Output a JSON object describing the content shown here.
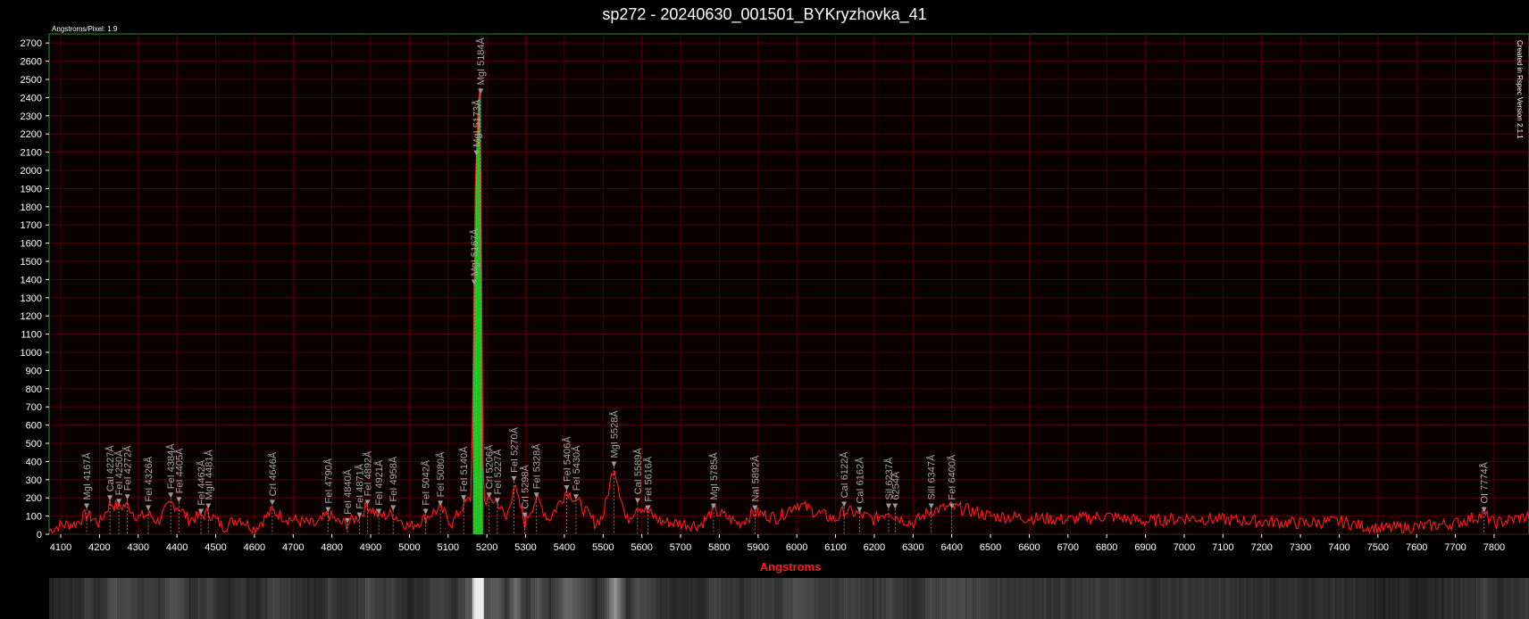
{
  "chart_data": {
    "type": "line",
    "title": "sp272 - 20240630_001501_BYKryzhovka_41",
    "subtitle": "Angstroms/Pixel: 1.9",
    "side_note": "Created in Rspec Version 2.1.1",
    "xlabel": "Angstroms",
    "ylabel": "",
    "xlim": [
      4070,
      7890
    ],
    "ylim": [
      0,
      2750
    ],
    "x_ticks": [
      4100,
      4200,
      4300,
      4400,
      4500,
      4600,
      4700,
      4800,
      4900,
      5000,
      5100,
      5200,
      5300,
      5400,
      5500,
      5600,
      5700,
      5800,
      5900,
      6000,
      6100,
      6200,
      6300,
      6400,
      6500,
      6600,
      6700,
      6800,
      6900,
      7000,
      7100,
      7200,
      7300,
      7400,
      7500,
      7600,
      7700,
      7800
    ],
    "y_ticks": [
      0,
      100,
      200,
      300,
      400,
      500,
      600,
      700,
      800,
      900,
      1000,
      1100,
      1200,
      1300,
      1400,
      1500,
      1600,
      1700,
      1800,
      1900,
      2000,
      2100,
      2200,
      2300,
      2400,
      2500,
      2600,
      2700
    ],
    "grid": true,
    "colors": {
      "line": "#ff1a1a",
      "grid": "#5a0000",
      "border": "#2a8f2a",
      "peak_fill": "#20d020",
      "marker": "#9a9a9a"
    },
    "series": [
      {
        "x": [
          4070,
          4100,
          4140,
          4167,
          4200,
          4227,
          4250,
          4272,
          4300,
          4326,
          4350,
          4384,
          4405,
          4430,
          4462,
          4481,
          4520,
          4560,
          4600,
          4646,
          4680,
          4720,
          4760,
          4790,
          4820,
          4840,
          4871,
          4892,
          4921,
          4958,
          5000,
          5042,
          5060,
          5080,
          5110,
          5140,
          5160,
          5167,
          5170,
          5173,
          5176,
          5180,
          5184,
          5188,
          5192,
          5206,
          5227,
          5250,
          5270,
          5298,
          5310,
          5328,
          5360,
          5406,
          5430,
          5480,
          5500,
          5528,
          5560,
          5589,
          5616,
          5650,
          5700,
          5750,
          5785,
          5850,
          5892,
          5950,
          6000,
          6050,
          6100,
          6122,
          6162,
          6200,
          6237,
          6254,
          6300,
          6347,
          6400,
          6450,
          6500,
          6600,
          6700,
          6800,
          6900,
          7000,
          7100,
          7200,
          7300,
          7400,
          7500,
          7600,
          7700,
          7774,
          7800,
          7890
        ],
        "y": [
          20,
          50,
          60,
          110,
          60,
          170,
          150,
          160,
          90,
          110,
          70,
          170,
          150,
          80,
          100,
          120,
          40,
          90,
          30,
          130,
          90,
          70,
          50,
          110,
          60,
          60,
          100,
          160,
          100,
          110,
          40,
          90,
          120,
          140,
          60,
          160,
          200,
          1350,
          1900,
          2100,
          2300,
          2440,
          2470,
          600,
          180,
          190,
          180,
          80,
          270,
          60,
          120,
          200,
          80,
          240,
          190,
          60,
          100,
          380,
          70,
          160,
          120,
          70,
          60,
          50,
          130,
          60,
          120,
          90,
          170,
          120,
          80,
          130,
          110,
          80,
          130,
          100,
          60,
          130,
          150,
          130,
          100,
          90,
          80,
          100,
          70,
          90,
          80,
          70,
          60,
          70,
          30,
          40,
          60,
          110,
          60,
          100
        ]
      }
    ],
    "annotations": [
      {
        "x": 4167,
        "text": "MgI 4167Å",
        "top": 140
      },
      {
        "x": 4227,
        "text": "CaI 4227Å",
        "top": 185
      },
      {
        "x": 4250,
        "text": "FeI 4250Å",
        "top": 165
      },
      {
        "x": 4272,
        "text": "FeI 4272Å",
        "top": 190
      },
      {
        "x": 4326,
        "text": "FeI 4326Å",
        "top": 130
      },
      {
        "x": 4384,
        "text": "FeI 4384Å",
        "top": 200
      },
      {
        "x": 4405,
        "text": "FeI 4405Å",
        "top": 175
      },
      {
        "x": 4462,
        "text": "FeI 4462Å",
        "top": 110
      },
      {
        "x": 4481,
        "text": "MgII 4481Å",
        "top": 140
      },
      {
        "x": 4646,
        "text": "CrI 4646Å",
        "top": 160
      },
      {
        "x": 4790,
        "text": "FeI 4790Å",
        "top": 120
      },
      {
        "x": 4840,
        "text": "FeI 4840Å",
        "top": 60
      },
      {
        "x": 4871,
        "text": "FeI 4871Å",
        "top": 90
      },
      {
        "x": 4892,
        "text": "FeI 4892Å",
        "top": 160
      },
      {
        "x": 4921,
        "text": "FeI 4921Å",
        "top": 110
      },
      {
        "x": 4958,
        "text": "FeI 4958Å",
        "top": 130
      },
      {
        "x": 5042,
        "text": "FeI 5042Å",
        "top": 110
      },
      {
        "x": 5080,
        "text": "FeI 5080Å",
        "top": 155
      },
      {
        "x": 5140,
        "text": "FeI 5140Å",
        "top": 185
      },
      {
        "x": 5167,
        "text": "MgI 5167Å",
        "top": 1370
      },
      {
        "x": 5173,
        "text": "MgI 5173Å",
        "top": 2080
      },
      {
        "x": 5184,
        "text": "MgI 5184Å",
        "top": 2420
      },
      {
        "x": 5206,
        "text": "CrI 5206Å",
        "top": 200
      },
      {
        "x": 5227,
        "text": "FeI 5227Å",
        "top": 170
      },
      {
        "x": 5270,
        "text": "FeI 5270Å",
        "top": 290
      },
      {
        "x": 5298,
        "text": "CrI 5298Å",
        "top": 90
      },
      {
        "x": 5328,
        "text": "FeI 5328Å",
        "top": 200
      },
      {
        "x": 5406,
        "text": "FeI 5406Å",
        "top": 240
      },
      {
        "x": 5430,
        "text": "FeI 5430Å",
        "top": 190
      },
      {
        "x": 5528,
        "text": "MgI 5528Å",
        "top": 370
      },
      {
        "x": 5589,
        "text": "CaI 5589Å",
        "top": 170
      },
      {
        "x": 5616,
        "text": "FeI 5616Å",
        "top": 130
      },
      {
        "x": 5785,
        "text": "MgI 5785Å",
        "top": 140
      },
      {
        "x": 5892,
        "text": "NaI 5892Å",
        "top": 130
      },
      {
        "x": 6122,
        "text": "CaI 6122Å",
        "top": 150
      },
      {
        "x": 6162,
        "text": "CaI 6162Å",
        "top": 120
      },
      {
        "x": 6237,
        "text": "SiI 6237Å",
        "top": 140
      },
      {
        "x": 6254,
        "text": "6254Å",
        "top": 140
      },
      {
        "x": 6347,
        "text": "SiII 6347Å",
        "top": 140
      },
      {
        "x": 6400,
        "text": "FeI 6400Å",
        "top": 140
      },
      {
        "x": 7774,
        "text": "OI 7774Å",
        "top": 120
      }
    ]
  }
}
